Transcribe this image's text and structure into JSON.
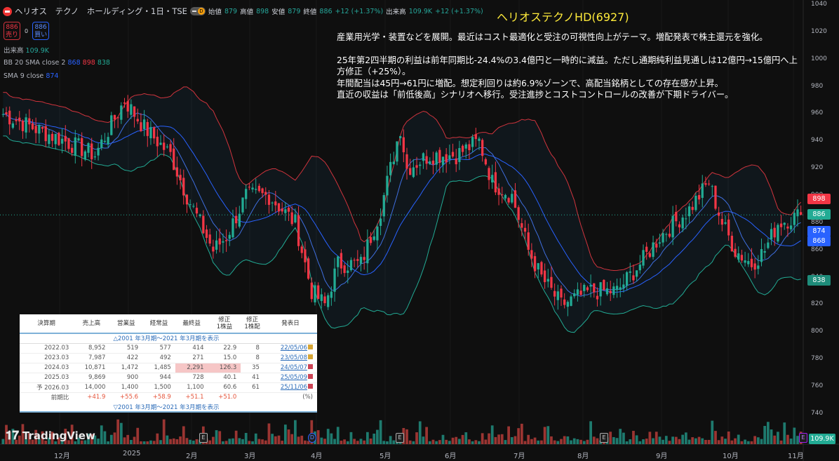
{
  "header": {
    "title": "ヘリオス　テクノ　ホールディング・1日・TSE",
    "interval_badge": "D",
    "ohlc": [
      {
        "k": "始値",
        "v": "879"
      },
      {
        "k": "高値",
        "v": "898"
      },
      {
        "k": "安値",
        "v": "879"
      },
      {
        "k": "終値",
        "v": "886"
      }
    ],
    "change": "+12 (+1.37%)",
    "volume_label": "出来高",
    "volume": "109.9K",
    "volume_change": "+12 (+1.37%)"
  },
  "trade": {
    "sell_price": "886",
    "sell_label": "売り",
    "spread": "0",
    "buy_price": "886",
    "buy_label": "買い"
  },
  "indicators": {
    "vol_label": "出来高",
    "vol_value": "109.9K",
    "bb_label": "BB 20 SMA close 2",
    "bb_mid": "868",
    "bb_up": "898",
    "bb_low": "838",
    "sma_label": "SMA 9 close",
    "sma_value": "874"
  },
  "annotation": {
    "title": "ヘリオステクノHD(6927)",
    "lines": [
      "産業用光学・装置などを展開。最近はコスト最適化と受注の可視性向上がテーマ。増配発表で株主還元を強化。",
      "",
      "25年第2四半期の利益は前年同期比-24.4%の3.4億円と一時的に減益。ただし通期純利益見通しは12億円→15億円へ上方修正（+25%）。",
      "年間配当は45円→61円に増配。想定利回りは約6.9%ゾーンで、高配当銘柄としての存在感が上昇。",
      "直近の収益は「前低後高」シナリオへ移行。受注進捗とコストコントロールの改善が下期ドライバー。"
    ]
  },
  "financials": {
    "headers": [
      "決算期",
      "売上高",
      "営業益",
      "経常益",
      "最終益",
      "修正\n1株益",
      "修正\n1株配",
      "発表日"
    ],
    "expand_top": "△2001 年3月期～2021 年3月期を表示",
    "rows": [
      [
        "2022.03",
        "8,952",
        "519",
        "577",
        "414",
        "22.9",
        "8",
        "22/05/06"
      ],
      [
        "2023.03",
        "7,987",
        "422",
        "492",
        "271",
        "15.0",
        "8",
        "23/05/08"
      ],
      [
        "2024.03",
        "10,871",
        "1,472",
        "1,485",
        "2,291",
        "126.3",
        "35",
        "24/05/07"
      ],
      [
        "2025.03",
        "9,869",
        "900",
        "944",
        "728",
        "40.1",
        "41",
        "25/05/09"
      ],
      [
        "予 2026.03",
        "14,000",
        "1,400",
        "1,500",
        "1,100",
        "60.6",
        "61",
        "25/11/06"
      ]
    ],
    "yoy": [
      "前期比",
      "+41.9",
      "+55.6",
      "+58.9",
      "+51.1",
      "+51.0",
      "",
      "(%)"
    ],
    "expand_bottom": "▽2001 年3月期～2021 年3月期を表示"
  },
  "brand": "TradingView",
  "price_tags": {
    "bb_up": "898",
    "last": "886",
    "sma": "874",
    "bb_mid": "868",
    "bb_low": "838",
    "volume": "109.9K"
  },
  "colors": {
    "up": "#22ab94",
    "down": "#f23645",
    "bb": "#d0343d",
    "sma": "#2962ff",
    "bb_low": "#22ab94"
  },
  "chart_data": {
    "type": "candlestick",
    "symbol": "6927",
    "ylim": [
      730,
      1040
    ],
    "yticks": [
      1040,
      1020,
      1000,
      980,
      960,
      940,
      920,
      900,
      880,
      860,
      840,
      820,
      800,
      780,
      760,
      740
    ],
    "months": [
      "12月",
      "2025",
      "2月",
      "3月",
      "4月",
      "5月",
      "6月",
      "7月",
      "8月",
      "9月",
      "10月",
      "11月"
    ],
    "close_path": [
      [
        0,
        960
      ],
      [
        9,
        950
      ],
      [
        19,
        940
      ],
      [
        28,
        930
      ],
      [
        37,
        970
      ],
      [
        43,
        950
      ],
      [
        51,
        930
      ],
      [
        56,
        900
      ],
      [
        64,
        860
      ],
      [
        68,
        870
      ],
      [
        74,
        900
      ],
      [
        81,
        900
      ],
      [
        89,
        880
      ],
      [
        94,
        830
      ],
      [
        98,
        820
      ],
      [
        102,
        850
      ],
      [
        109,
        850
      ],
      [
        115,
        890
      ],
      [
        121,
        950
      ],
      [
        123,
        920
      ],
      [
        130,
        930
      ],
      [
        138,
        930
      ],
      [
        145,
        940
      ],
      [
        149,
        910
      ],
      [
        155,
        900
      ],
      [
        160,
        860
      ],
      [
        164,
        840
      ],
      [
        170,
        820
      ],
      [
        179,
        830
      ],
      [
        187,
        830
      ],
      [
        194,
        850
      ],
      [
        200,
        870
      ],
      [
        209,
        890
      ],
      [
        215,
        910
      ],
      [
        219,
        880
      ],
      [
        223,
        860
      ],
      [
        228,
        850
      ],
      [
        232,
        860
      ],
      [
        236,
        880
      ],
      [
        243,
        886
      ]
    ],
    "last": 886
  }
}
